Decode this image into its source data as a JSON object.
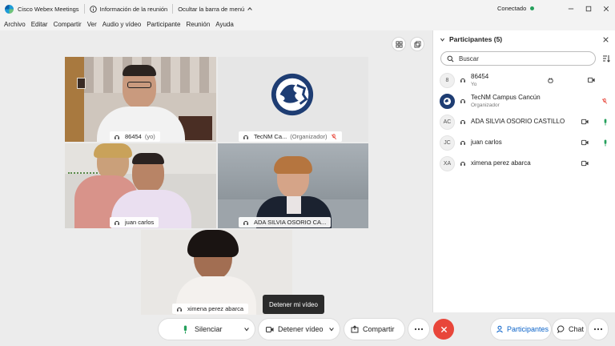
{
  "app": {
    "title": "Cisco Webex Meetings"
  },
  "titlebar": {
    "meeting_info": "Información de la reunión",
    "hide_menu": "Ocultar la barra de menú",
    "status": "Conectado"
  },
  "menu": [
    "Archivo",
    "Editar",
    "Compartir",
    "Ver",
    "Audio y vídeo",
    "Participante",
    "Reunión",
    "Ayuda"
  ],
  "tiles": {
    "t1": {
      "name": "86454",
      "suffix": "(yo)"
    },
    "t2": {
      "name": "TecNM Ca...",
      "suffix": "(Organizador)"
    },
    "t3": {
      "name": "juan carlos"
    },
    "t4": {
      "name": "ADA SILVIA OSORIO CA..."
    },
    "t5": {
      "name": "ximena perez abarca"
    }
  },
  "tooltip": "Detener mi vídeo",
  "panel": {
    "title": "Participantes (5)",
    "search_placeholder": "Buscar",
    "participants": [
      {
        "initials": "8",
        "name": "86454",
        "role": "Yo"
      },
      {
        "initials": "",
        "name": "TecNM Campus Cancún",
        "role": "Organizador"
      },
      {
        "initials": "AC",
        "name": "ADA SILVIA OSORIO CASTILLO",
        "role": ""
      },
      {
        "initials": "JC",
        "name": "juan carlos",
        "role": ""
      },
      {
        "initials": "XA",
        "name": "ximena perez abarca",
        "role": ""
      }
    ]
  },
  "controls": {
    "mute": "Silenciar",
    "stop_video": "Detener vídeo",
    "share": "Compartir",
    "participants": "Participantes",
    "chat": "Chat"
  },
  "colors": {
    "accent": "#0b63c9",
    "end_call": "#e8463a",
    "mic_active": "#25a05c",
    "status_dot": "#25a05c"
  }
}
